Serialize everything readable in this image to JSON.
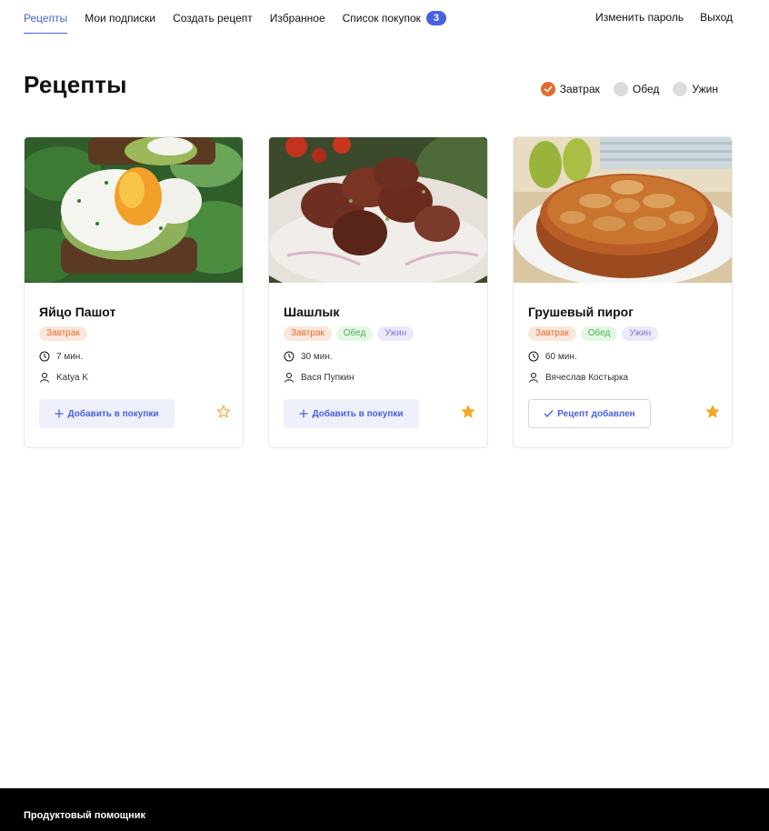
{
  "nav": {
    "items": [
      {
        "label": "Рецепты",
        "active": true
      },
      {
        "label": "Мои подписки"
      },
      {
        "label": "Создать рецепт"
      },
      {
        "label": "Избранное"
      },
      {
        "label": "Список покупок",
        "badge": "3"
      }
    ],
    "right": [
      {
        "label": "Изменить пароль"
      },
      {
        "label": "Выход"
      }
    ]
  },
  "page": {
    "title": "Рецепты",
    "filters": [
      {
        "label": "Завтрак",
        "checked": true
      },
      {
        "label": "Обед",
        "checked": false
      },
      {
        "label": "Ужин",
        "checked": false
      }
    ]
  },
  "cards": [
    {
      "title": "Яйцо Пашот",
      "tags": [
        "Завтрак"
      ],
      "time": "7 мин.",
      "author": "Katya K",
      "button": "Добавить в покупки",
      "favorite": false
    },
    {
      "title": "Шашлык",
      "tags": [
        "Завтрак",
        "Обед",
        "Ужин"
      ],
      "time": "30 мин.",
      "author": "Вася Пупкин",
      "button": "Добавить в покупки",
      "favorite": true
    },
    {
      "title": "Грушевый пирог",
      "tags": [
        "Завтрак",
        "Обед",
        "Ужин"
      ],
      "time": "60 мин.",
      "author": "Вячеслав Костырка",
      "button": "Рецепт добавлен",
      "favorite": true
    }
  ],
  "footer": {
    "text": "Продуктовый помощник"
  },
  "colors": {
    "accent": "#4a61dd",
    "breakfast": "#e26c2d",
    "lunch": "#49b64e",
    "dinner": "#8775d2",
    "star": "#f5a623"
  }
}
